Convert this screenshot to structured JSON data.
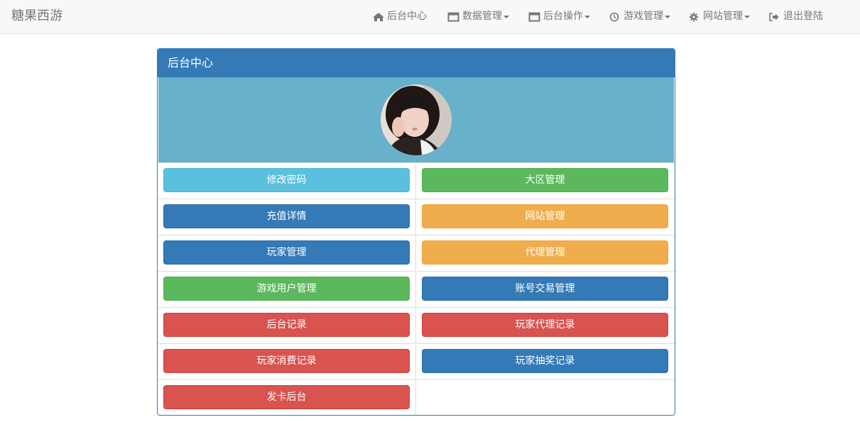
{
  "navbar": {
    "brand": "糖果西游",
    "items": [
      {
        "label": "后台中心",
        "icon": "home-icon",
        "dropdown": false
      },
      {
        "label": "数据管理",
        "icon": "window-icon",
        "dropdown": true
      },
      {
        "label": "后台操作",
        "icon": "window-icon",
        "dropdown": true
      },
      {
        "label": "游戏管理",
        "icon": "clock-icon",
        "dropdown": true
      },
      {
        "label": "网站管理",
        "icon": "gear-icon",
        "dropdown": true
      },
      {
        "label": "退出登陆",
        "icon": "logout-icon",
        "dropdown": false
      }
    ]
  },
  "panel": {
    "title": "后台中心",
    "buttons": [
      {
        "label": "修改密码",
        "style": "info"
      },
      {
        "label": "大区管理",
        "style": "success"
      },
      {
        "label": "充值详情",
        "style": "primary"
      },
      {
        "label": "网站管理",
        "style": "warning"
      },
      {
        "label": "玩家管理",
        "style": "primary"
      },
      {
        "label": "代理管理",
        "style": "warning"
      },
      {
        "label": "游戏用户管理",
        "style": "success"
      },
      {
        "label": "账号交易管理",
        "style": "primary"
      },
      {
        "label": "后台记录",
        "style": "danger"
      },
      {
        "label": "玩家代理记录",
        "style": "danger"
      },
      {
        "label": "玩家消费记录",
        "style": "danger"
      },
      {
        "label": "玩家抽奖记录",
        "style": "primary"
      },
      {
        "label": "发卡后台",
        "style": "danger"
      }
    ]
  },
  "colors": {
    "navbar_bg": "#f8f8f8",
    "panel_primary": "#337ab7",
    "avatar_band": "#67b1ca",
    "info": "#5bc0de",
    "success": "#5cb85c",
    "warning": "#f0ad4e",
    "danger": "#d9534f"
  }
}
